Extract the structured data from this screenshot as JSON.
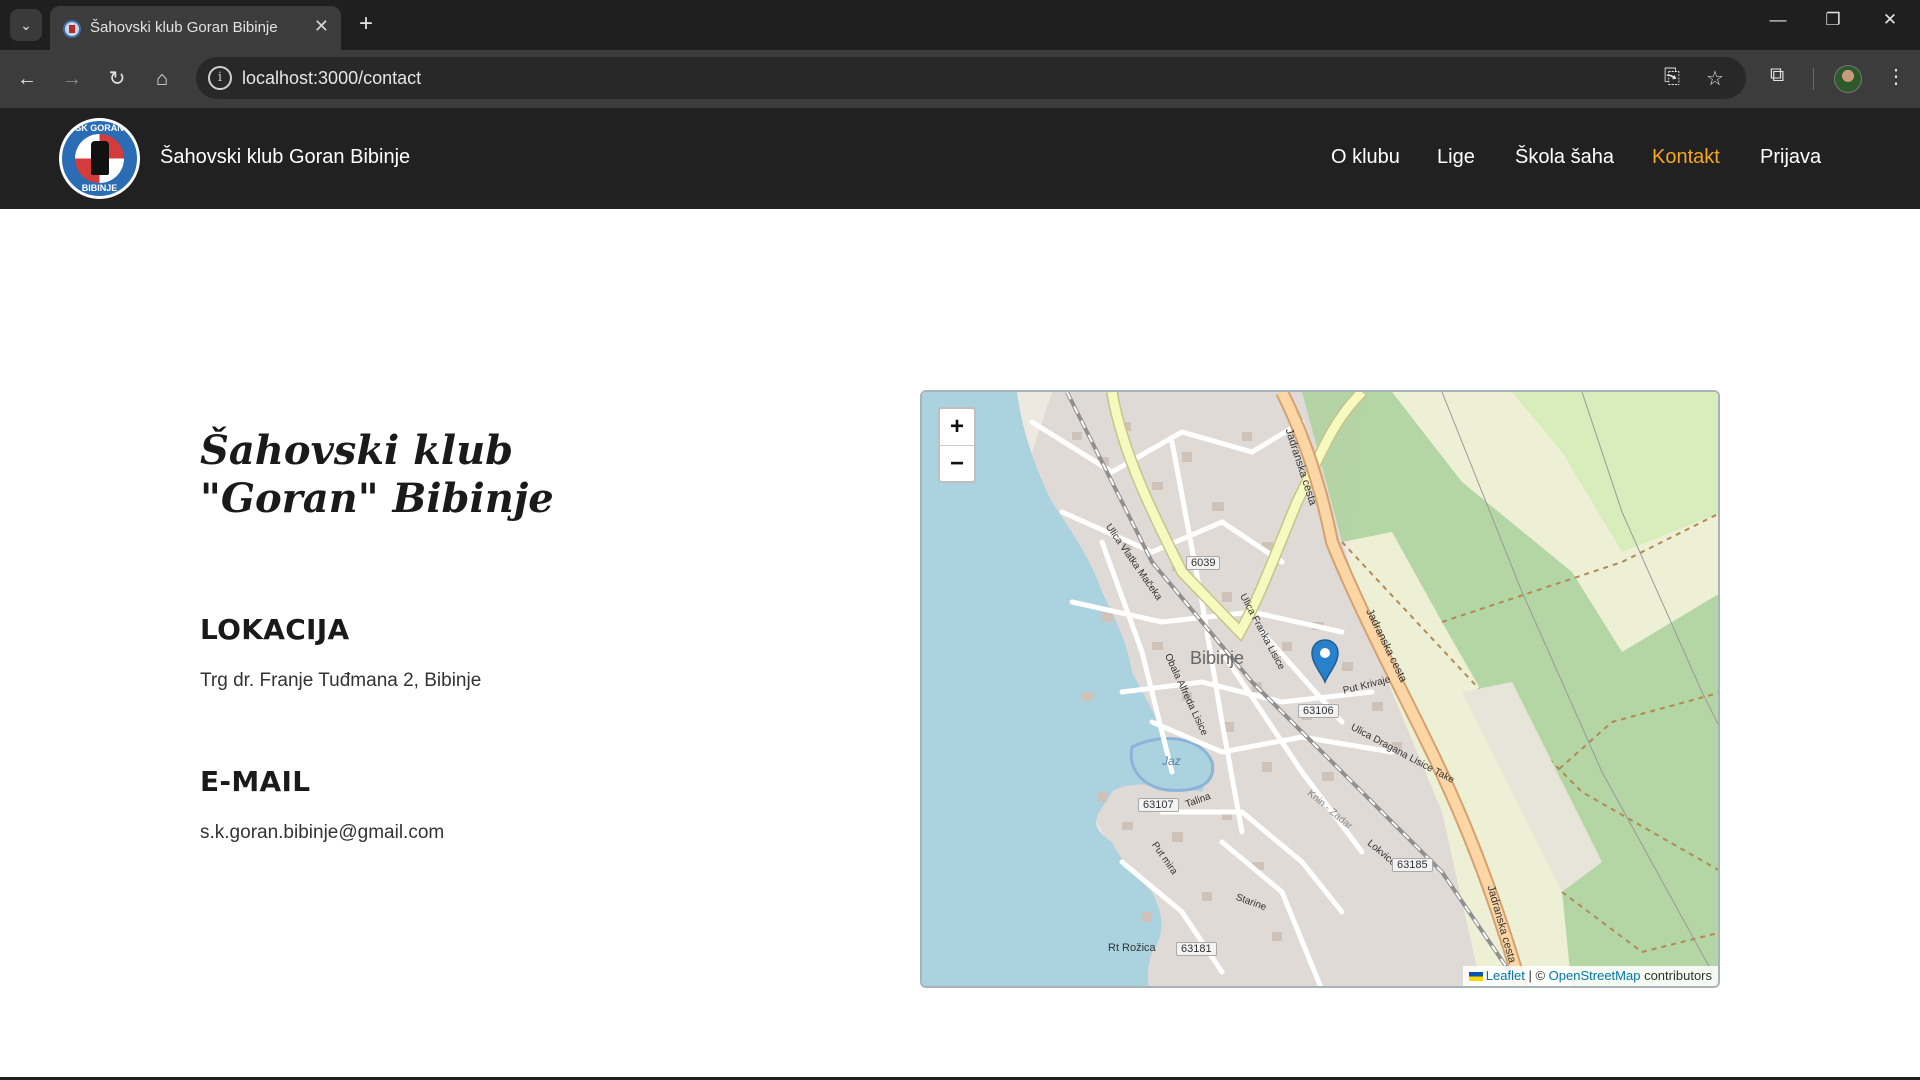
{
  "browser": {
    "tab_title": "Šahovski klub Goran Bibinje",
    "url": "localhost:3000/contact"
  },
  "header": {
    "logo_text_top": "ŠK GORAN",
    "logo_text_bottom": "BIBINJE",
    "site_name": "Šahovski klub Goran Bibinje",
    "nav": [
      {
        "label": "O klubu",
        "active": false
      },
      {
        "label": "Lige",
        "active": false
      },
      {
        "label": "Škola šaha",
        "active": false
      },
      {
        "label": "Kontakt",
        "active": true
      },
      {
        "label": "Prijava",
        "active": false
      }
    ]
  },
  "content": {
    "club_title": "Šahovski klub \"Goran\" Bibinje",
    "location_heading": "LOKACIJA",
    "location_text": "Trg dr. Franje Tuđmana 2, Bibinje",
    "email_heading": "E-MAIL",
    "email_text": "s.k.goran.bibinje@gmail.com"
  },
  "map": {
    "zoom_in": "+",
    "zoom_out": "−",
    "attribution_leaflet": "Leaflet",
    "attribution_sep": "| ©",
    "attribution_osm": "OpenStreetMap",
    "attribution_suffix": "contributors",
    "labels": {
      "town": "Bibinje",
      "road1": "Jadranska cesta",
      "road2": "Jadranska cesta",
      "road3": "Jadranska cesta",
      "jaz": "Jaz",
      "rt": "Rt Rožica",
      "street1": "Ulica Franka Lisice",
      "street2": "Obala Alfreda Lisice",
      "street3": "Ulica Dragana Lisice Take",
      "street4": "Put Krivaje",
      "street5": "Put mira",
      "street6": "Starine",
      "street7": "Talina",
      "street8": "Knin - Zadar",
      "street9": "Lokvice",
      "street10": "Ulica Vlatka Mačeka"
    },
    "route_numbers": [
      "6039",
      "63106",
      "63107",
      "63185",
      "63181"
    ],
    "colors": {
      "sea": "#aad3df",
      "land": "#f2efe9",
      "forest": "#add19e",
      "meadow": "#cdebb0",
      "farmland": "#eef0d5",
      "primary_road": "#fcd6a4",
      "secondary_road": "#f7fabf",
      "buildings": "#d9d0c9",
      "marker": "#2a81cb"
    }
  }
}
